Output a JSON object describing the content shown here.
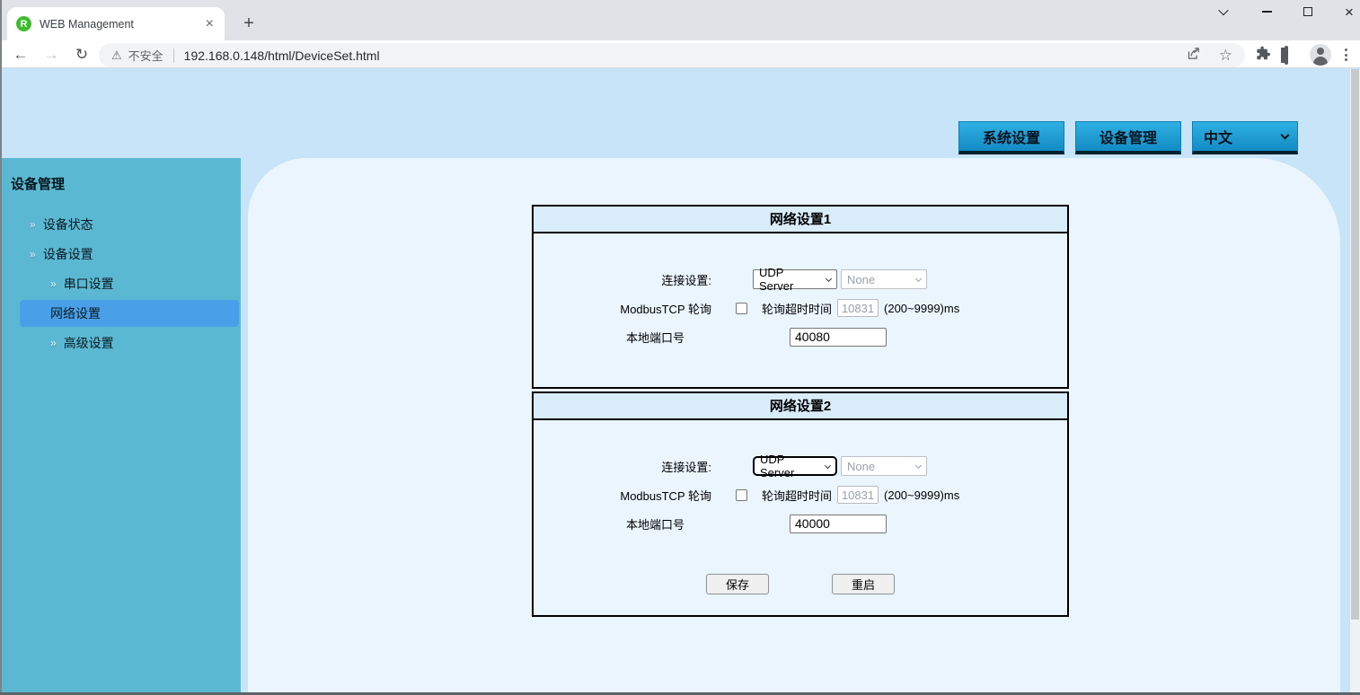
{
  "browser": {
    "tab": {
      "title": "WEB Management"
    },
    "url": {
      "security_label": "不安全",
      "address": "192.168.0.148/html/DeviceSet.html"
    }
  },
  "icons": {
    "favicon_letter": "R",
    "new_tab": "+",
    "tab_close": "×",
    "back": "←",
    "forward": "→",
    "reload": "↻",
    "warning": "⚠",
    "star": "☆"
  },
  "header": {
    "buttons": [
      {
        "label": "系统设置"
      },
      {
        "label": "设备管理"
      }
    ],
    "language_select": {
      "value": "中文"
    }
  },
  "sidebar": {
    "title": "设备管理",
    "arrow_glyph": "»",
    "items": [
      {
        "label": "设备状态",
        "level": 1,
        "active": false
      },
      {
        "label": "设备设置",
        "level": 1,
        "active": false
      },
      {
        "label": "串口设置",
        "level": 2,
        "active": false
      },
      {
        "label": "网络设置",
        "level": 2,
        "active": true
      },
      {
        "label": "高级设置",
        "level": 2,
        "active": false
      }
    ]
  },
  "panels": [
    {
      "title": "网络设置1",
      "connection_label": "连接设置:",
      "connection_value": "UDP Server",
      "secondary_value": "None",
      "modbus_label": "ModbusTCP 轮询",
      "modbus_checked": false,
      "timeout_label": "轮询超时时间",
      "timeout_value": "10831",
      "timeout_range": "(200~9999)ms",
      "port_label": "本地端口号",
      "port_value": "40080"
    },
    {
      "title": "网络设置2",
      "connection_label": "连接设置:",
      "connection_value": "UDP Server",
      "secondary_value": "None",
      "modbus_label": "ModbusTCP 轮询",
      "modbus_checked": false,
      "timeout_label": "轮询超时时间",
      "timeout_value": "10831",
      "timeout_range": "(200~9999)ms",
      "port_label": "本地端口号",
      "port_value": "40000"
    }
  ],
  "actions": {
    "save": "保存",
    "restart": "重启"
  },
  "colors": {
    "page_background": "#c7e4f8",
    "content_panel": "#eaf5fd",
    "sidebar": "#5bb8d3",
    "sidebar_active": "#4aa0e8",
    "header_button": "#1b9fd6",
    "box_title_bg": "#d9ecfa",
    "favicon_green": "#3dbd2e"
  }
}
